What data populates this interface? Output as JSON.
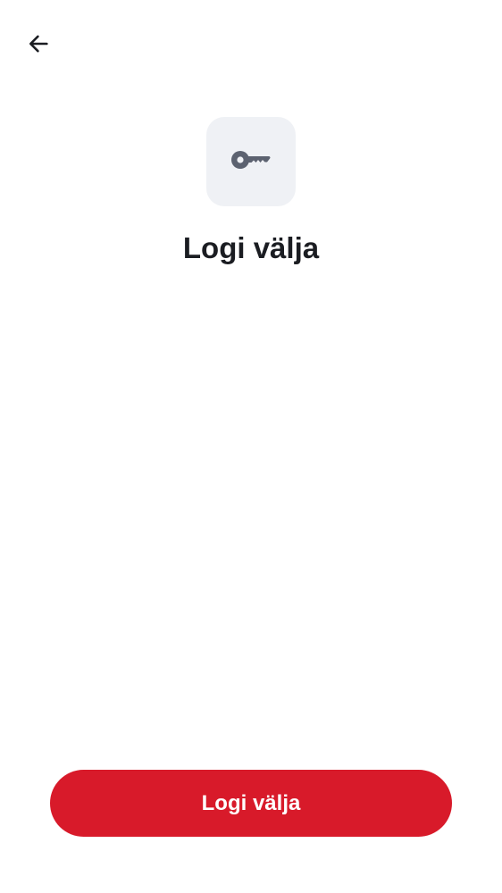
{
  "header": {
    "back_icon": "arrow-left-icon"
  },
  "hero": {
    "icon": "key-icon",
    "title": "Logi välja"
  },
  "footer": {
    "primary_button_label": "Logi välja"
  },
  "colors": {
    "accent": "#d81a2a",
    "icon_tile_bg": "#eff1f5",
    "icon_fg": "#5c6270",
    "text": "#1b1d22"
  }
}
